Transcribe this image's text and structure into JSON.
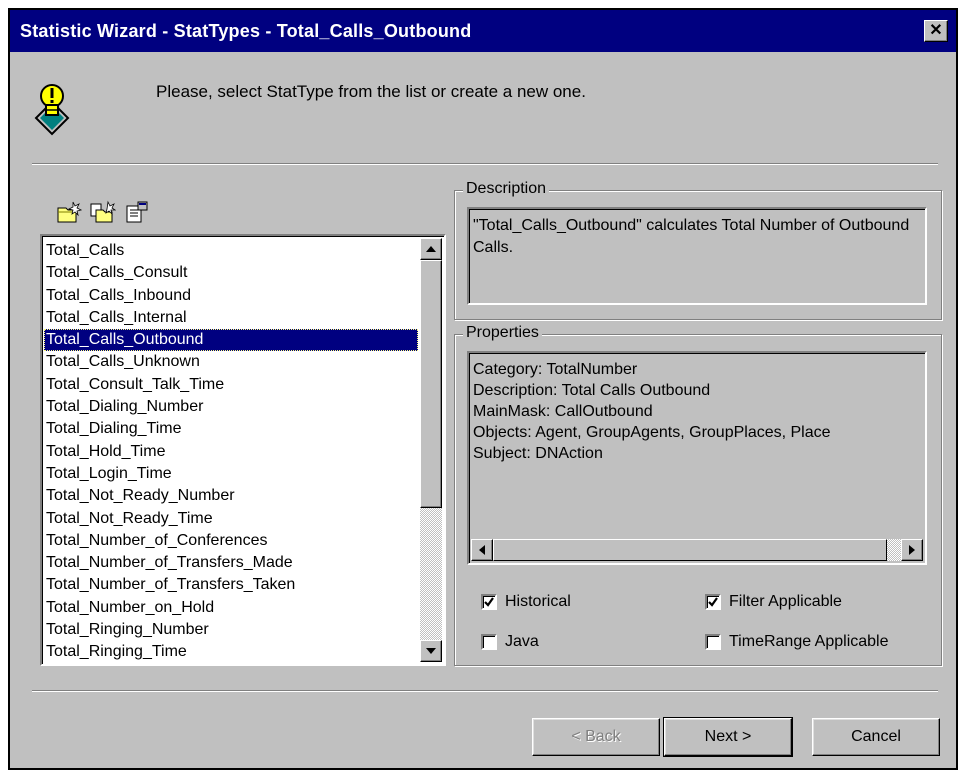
{
  "window": {
    "title": "Statistic Wizard - StatTypes - Total_Calls_Outbound",
    "close_glyph": "✕"
  },
  "instruction": "Please, select StatType from the list or create a new one.",
  "icons": {
    "header": "lightbulb-warning-icon",
    "toolbar": [
      "new-stattype-icon",
      "copy-stattype-icon",
      "properties-icon"
    ],
    "scroll_up": "arrow-up-icon",
    "scroll_down": "arrow-down-icon",
    "scroll_left": "arrow-left-icon",
    "scroll_right": "arrow-right-icon"
  },
  "stattypes": {
    "items": [
      "Total_Calls",
      "Total_Calls_Consult",
      "Total_Calls_Inbound",
      "Total_Calls_Internal",
      "Total_Calls_Outbound",
      "Total_Calls_Unknown",
      "Total_Consult_Talk_Time",
      "Total_Dialing_Number",
      "Total_Dialing_Time",
      "Total_Hold_Time",
      "Total_Login_Time",
      "Total_Not_Ready_Number",
      "Total_Not_Ready_Time",
      "Total_Number_of_Conferences",
      "Total_Number_of_Transfers_Made",
      "Total_Number_of_Transfers_Taken",
      "Total_Number_on_Hold",
      "Total_Ringing_Number",
      "Total_Ringing_Time"
    ],
    "selected": "Total_Calls_Outbound"
  },
  "description": {
    "label": "Description",
    "text": "\"Total_Calls_Outbound\" calculates Total Number of Outbound Calls."
  },
  "properties": {
    "label": "Properties",
    "lines": [
      "Category: TotalNumber",
      "Description: Total Calls Outbound",
      "MainMask: CallOutbound",
      "Objects: Agent, GroupAgents, GroupPlaces, Place",
      "Subject: DNAction"
    ]
  },
  "options": {
    "historical": {
      "label": "Historical",
      "checked": true
    },
    "filter_applicable": {
      "label": "Filter Applicable",
      "checked": true
    },
    "java": {
      "label": "Java",
      "checked": false
    },
    "timerange_applicable": {
      "label": "TimeRange Applicable",
      "checked": false
    }
  },
  "buttons": {
    "back": "< Back",
    "next": "Next >",
    "cancel": "Cancel"
  },
  "colors": {
    "titlebar": "#000080",
    "dialog_bg": "#c0c0c0",
    "selection": "#000080"
  }
}
